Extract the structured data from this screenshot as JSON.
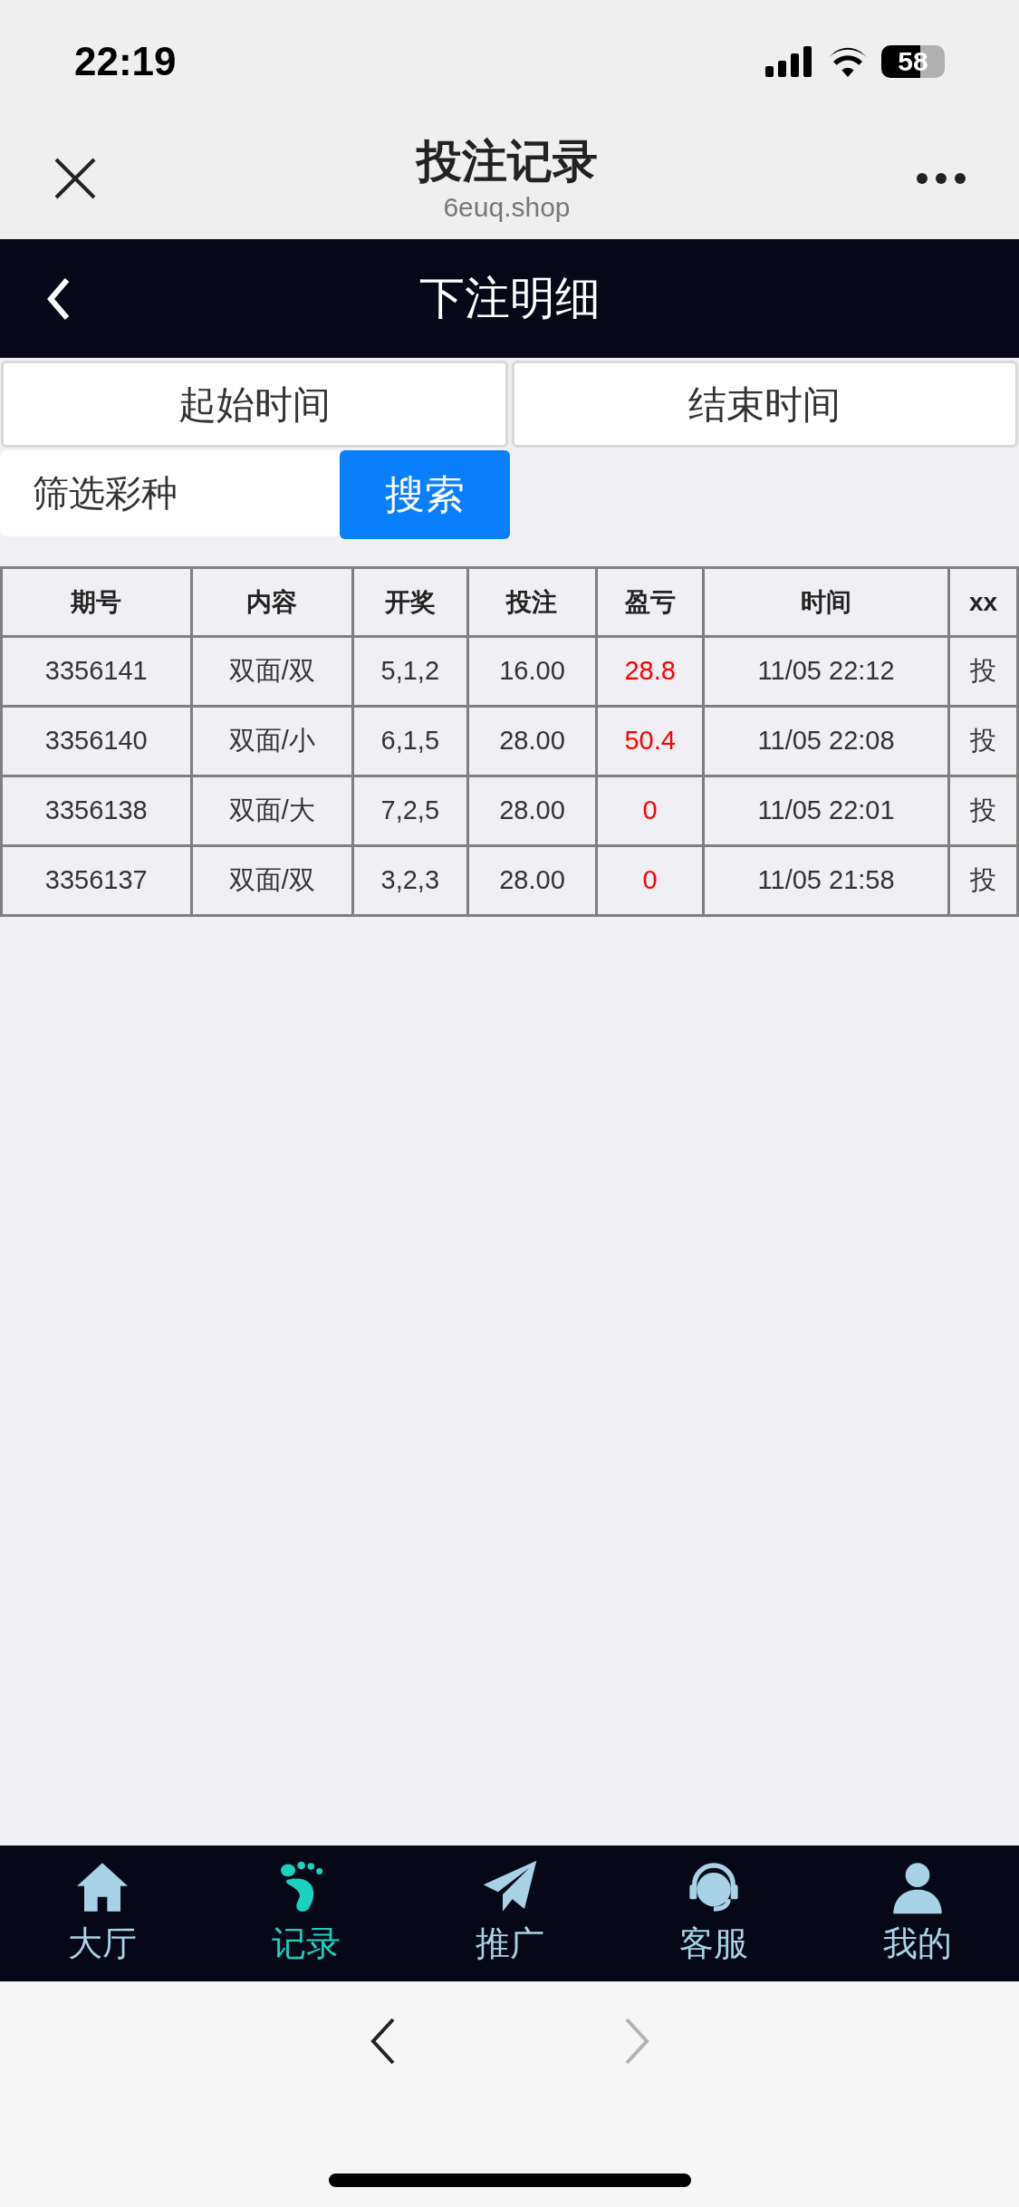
{
  "status_bar": {
    "time": "22:19",
    "battery": "58"
  },
  "browser_header": {
    "title": "投注记录",
    "domain": "6euq.shop"
  },
  "page_header": {
    "title": "下注明细"
  },
  "date_buttons": [
    "起始时间",
    "结束时间"
  ],
  "filter": {
    "placeholder": "筛选彩种",
    "button": "搜索"
  },
  "table": {
    "columns": [
      "期号",
      "内容",
      "开奖",
      "投注",
      "盈亏",
      "时间",
      "xx"
    ],
    "rows": [
      [
        "3356141",
        "双面/双",
        "5,1,2",
        "16.00",
        "28.8",
        "11/05 22:12",
        "投"
      ],
      [
        "3356140",
        "双面/小",
        "6,1,5",
        "28.00",
        "50.4",
        "11/05 22:08",
        "投"
      ],
      [
        "3356138",
        "双面/大",
        "7,2,5",
        "28.00",
        "0",
        "11/05 22:01",
        "投"
      ],
      [
        "3356137",
        "双面/双",
        "3,2,3",
        "28.00",
        "0",
        "11/05 21:58",
        "投"
      ]
    ]
  },
  "bottom_nav": [
    {
      "label": "大厅",
      "kind": "home",
      "selected": false
    },
    {
      "label": "记录",
      "kind": "foot",
      "selected": true
    },
    {
      "label": "推广",
      "kind": "plane",
      "selected": false
    },
    {
      "label": "客服",
      "kind": "support",
      "selected": false
    },
    {
      "label": "我的",
      "kind": "user",
      "selected": false
    }
  ],
  "browser_toolbar": {
    "back_disabled": false,
    "forward_disabled": true
  }
}
